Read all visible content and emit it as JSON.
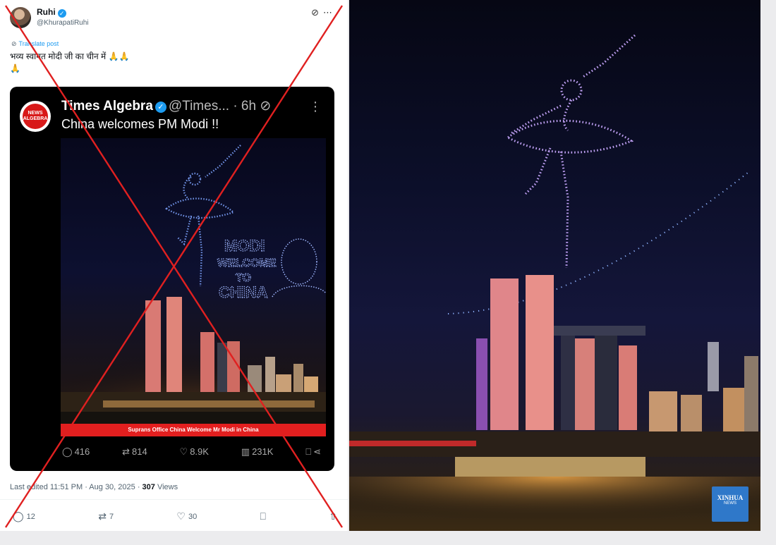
{
  "tweet": {
    "author_name": "Ruhi",
    "handle": "@KhurapatiRuhi",
    "translate_label": "Translate post",
    "text": "भव्य स्वागत मोदी जी का चीन में 🙏🙏",
    "text_line2": "🙏",
    "meta_time": "Last edited 11:51 PM · Aug 30, 2025 · ",
    "meta_views_count": "307",
    "meta_views_label": " Views",
    "replies": "12",
    "reposts": "7",
    "likes": "30"
  },
  "embed": {
    "logo_line1": "NEWS",
    "logo_line2": "ALGEBRA",
    "author_name": "Times Algebra",
    "handle": "@Times...",
    "time": "· 6h",
    "text": "China welcomes PM Modi !!",
    "image_text_l1": "MODI",
    "image_text_l2": "WELCOME",
    "image_text_l3": "TO",
    "image_text_l4": "CHINA",
    "caption": "Suprans Office China Welcome Mr Modi in China",
    "replies": "416",
    "reposts": "814",
    "likes": "8.9K",
    "views": "231K"
  },
  "photo": {
    "watermark_line1": "XINHUA",
    "watermark_line2": "NEWS"
  },
  "colors": {
    "cross_red": "#e02020",
    "x_blue": "#1d9bf0",
    "caption_red": "#e21f1f",
    "xinhua_blue": "#2f78c9"
  },
  "icons": [
    "verified-icon",
    "grok-icon",
    "more-icon",
    "translate-icon",
    "reply-icon",
    "repost-icon",
    "like-icon",
    "views-icon",
    "bookmark-icon",
    "share-icon"
  ]
}
